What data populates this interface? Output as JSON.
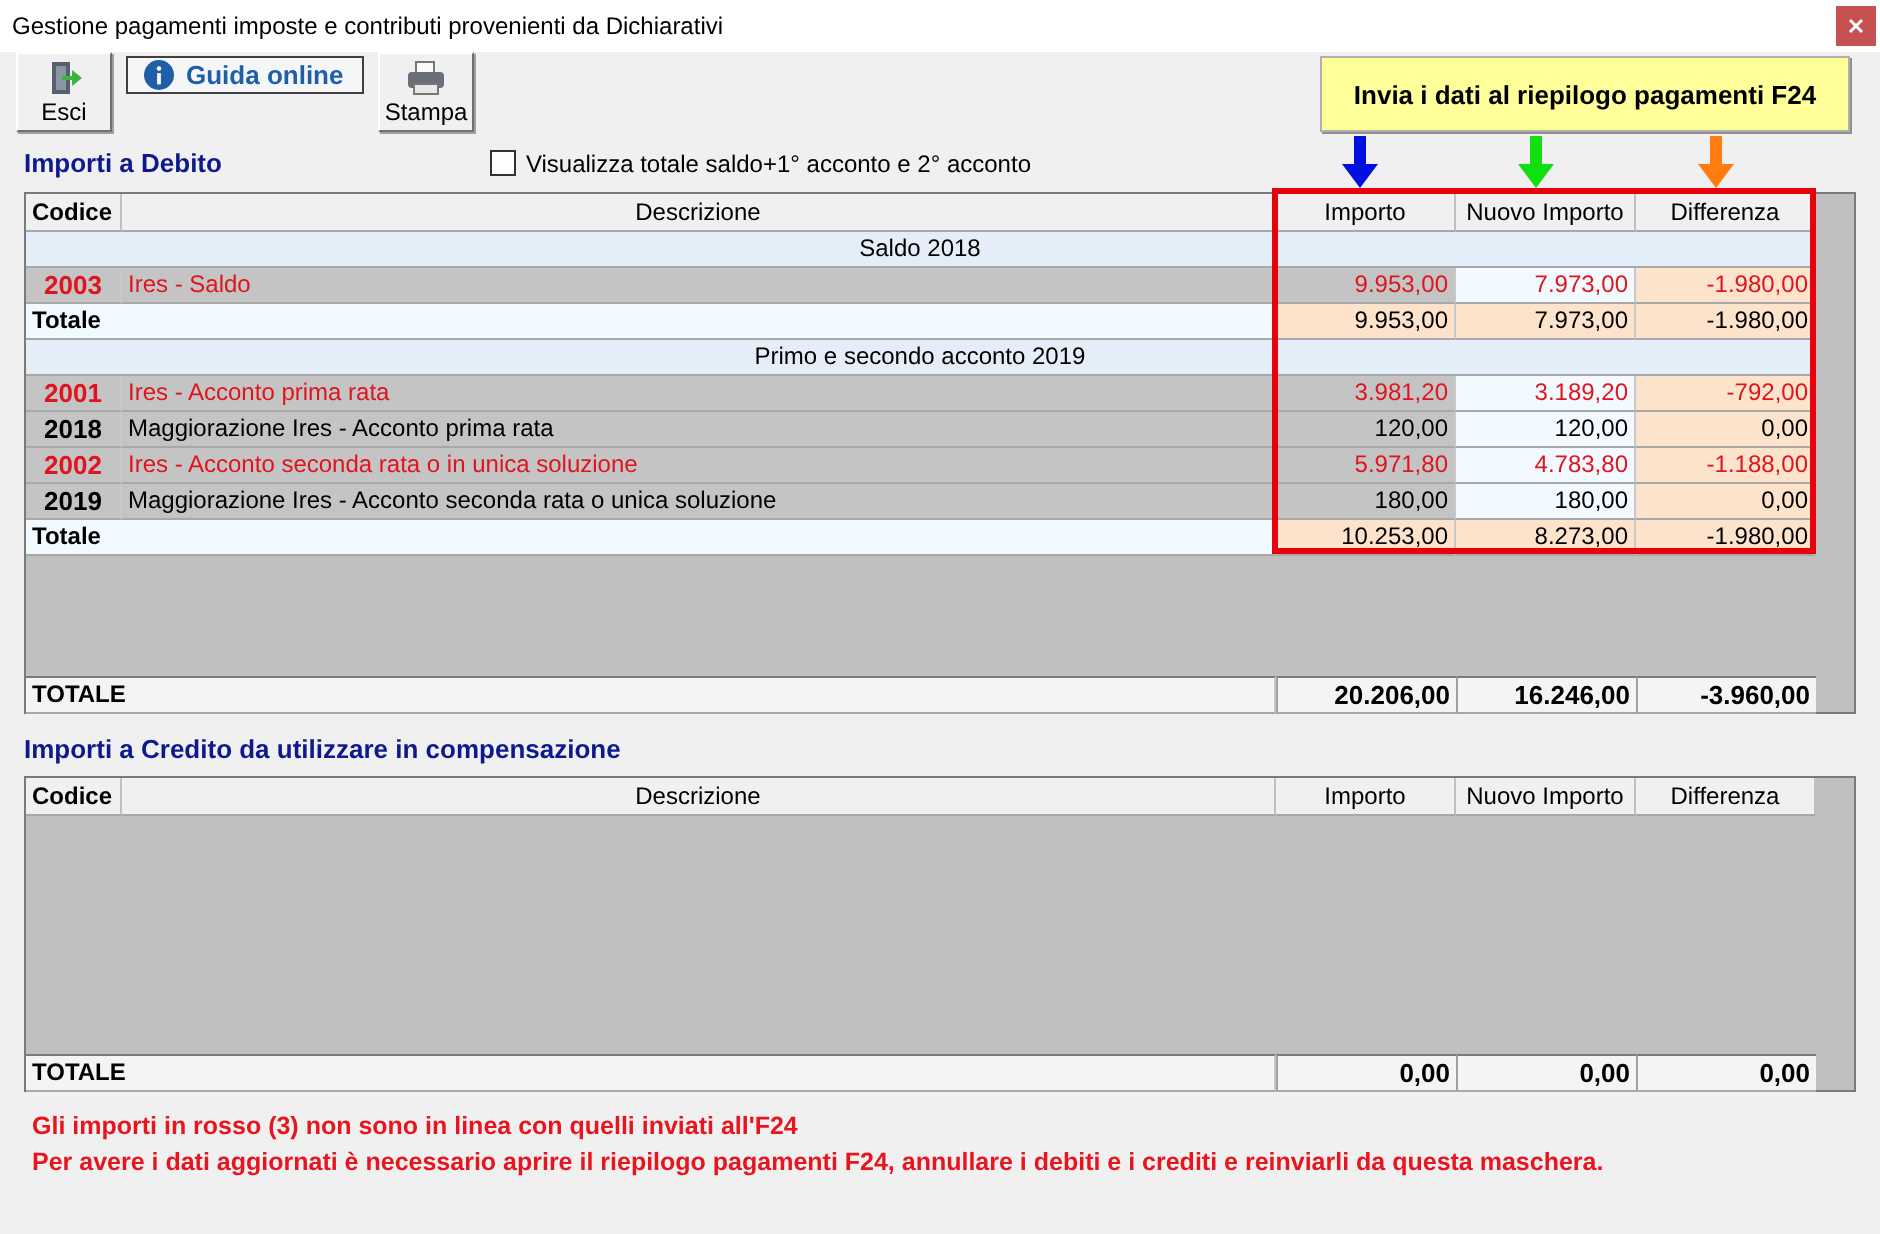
{
  "window": {
    "title": "Gestione pagamenti imposte e contributi provenienti da Dichiarativi"
  },
  "toolbar": {
    "buttons": [
      {
        "kind": "exit",
        "label": "Esci"
      },
      {
        "kind": "help",
        "label": "Guida online"
      },
      {
        "kind": "print",
        "label": "Stampa"
      }
    ],
    "send_button": "Invia i dati al riepilogo pagamenti F24"
  },
  "debit": {
    "title": "Importi a Debito",
    "show_totals": {
      "label": "Visualizza totale saldo+1° acconto e 2° acconto",
      "checked": false
    },
    "columns": [
      "Codice",
      "Descrizione",
      "Importo",
      "Nuovo Importo",
      "Differenza"
    ],
    "rows": [
      {
        "kind": "section",
        "label": "Saldo 2018"
      },
      {
        "kind": "item",
        "code": "2003",
        "description": "Ires - Saldo",
        "importo": "9.953,00",
        "nuovo_importo": "7.973,00",
        "differenza": "-1.980,00",
        "mismatch": true
      },
      {
        "kind": "total",
        "label": "Totale",
        "importo": "9.953,00",
        "nuovo_importo": "7.973,00",
        "differenza": "-1.980,00"
      },
      {
        "kind": "section",
        "label": "Primo e secondo acconto 2019"
      },
      {
        "kind": "item",
        "code": "2001",
        "description": "Ires - Acconto prima rata",
        "importo": "3.981,20",
        "nuovo_importo": "3.189,20",
        "differenza": "-792,00",
        "mismatch": true
      },
      {
        "kind": "item",
        "code": "2018",
        "description": "Maggiorazione Ires - Acconto prima rata",
        "importo": "120,00",
        "nuovo_importo": "120,00",
        "differenza": "0,00",
        "mismatch": false
      },
      {
        "kind": "item",
        "code": "2002",
        "description": "Ires - Acconto seconda rata o in unica soluzione",
        "importo": "5.971,80",
        "nuovo_importo": "4.783,80",
        "differenza": "-1.188,00",
        "mismatch": true
      },
      {
        "kind": "item",
        "code": "2019",
        "description": "Maggiorazione Ires - Acconto seconda rata o unica soluzione",
        "importo": "180,00",
        "nuovo_importo": "180,00",
        "differenza": "0,00",
        "mismatch": false
      },
      {
        "kind": "total",
        "label": "Totale",
        "importo": "10.253,00",
        "nuovo_importo": "8.273,00",
        "differenza": "-1.980,00"
      }
    ],
    "grand_total": {
      "label": "TOTALE",
      "importo": "20.206,00",
      "nuovo_importo": "16.246,00",
      "differenza": "-3.960,00"
    }
  },
  "credit": {
    "title": "Importi a Credito da utilizzare in compensazione",
    "columns": [
      "Codice",
      "Descrizione",
      "Importo",
      "Nuovo Importo",
      "Differenza"
    ],
    "grand_total": {
      "label": "TOTALE",
      "importo": "0,00",
      "nuovo_importo": "0,00",
      "differenza": "0,00"
    }
  },
  "notes": [
    "Gli importi in rosso (3) non sono in linea con quelli inviati all'F24",
    "Per avere i dati aggiornati è necessario aprire il riepilogo pagamenti F24, annullare i debiti e i crediti e reinviarli da questa maschera."
  ]
}
